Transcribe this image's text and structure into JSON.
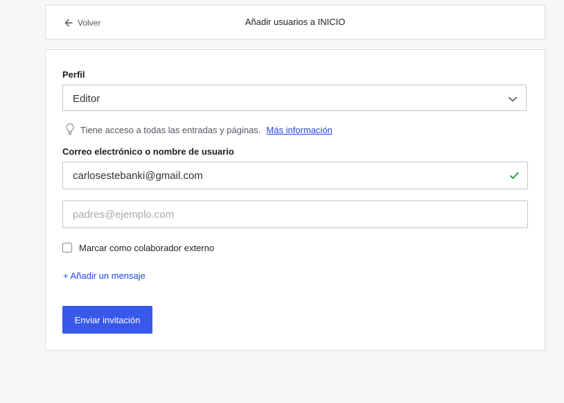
{
  "header": {
    "back_label": "Volver",
    "title": "Añadir usuarios a INICIO"
  },
  "form": {
    "profile_label": "Perfil",
    "profile_value": "Editor",
    "hint_text": "Tiene acceso a todas las entradas y páginas.",
    "hint_link": "Más información",
    "email_label": "Correo electrónico o nombre de usuario",
    "email_value_1": "carlosestebanki@gmail.com",
    "email_placeholder_2": "padres@ejemplo.com",
    "external_checkbox_label": "Marcar como colaborador externo",
    "external_checkbox_checked": false,
    "add_message_label": "+ Añadir un mensaje",
    "submit_label": "Enviar invitación"
  },
  "colors": {
    "accent": "#3858e9",
    "link": "#2145e6",
    "valid": "#008a20"
  },
  "icons": {
    "back": "arrow-left-icon",
    "select": "chevron-down-icon",
    "hint": "lightbulb-icon",
    "valid": "checkmark-icon"
  }
}
